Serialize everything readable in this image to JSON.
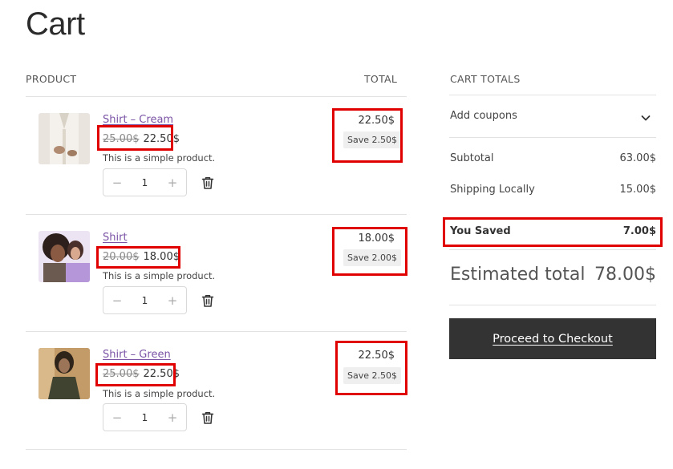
{
  "page": {
    "title": "Cart"
  },
  "table": {
    "col_product": "PRODUCT",
    "col_total": "TOTAL"
  },
  "items": [
    {
      "name": "Shirt – Cream",
      "regular_price": "25.00$",
      "sale_price": "22.50$",
      "description": "This is a simple product.",
      "quantity": "1",
      "line_total": "22.50$",
      "save_label": "Save 2.50$",
      "thumb_palette": [
        "#e9e4de",
        "#cfc7bb",
        "#8c7b6a"
      ]
    },
    {
      "name": "Shirt",
      "regular_price": "20.00$",
      "sale_price": "18.00$",
      "description": "This is a simple product.",
      "quantity": "1",
      "line_total": "18.00$",
      "save_label": "Save 2.00$",
      "thumb_palette": [
        "#d9c9e6",
        "#b79ad6",
        "#3b2a2a"
      ]
    },
    {
      "name": "Shirt – Green",
      "regular_price": "25.00$",
      "sale_price": "22.50$",
      "description": "This is a simple product.",
      "quantity": "1",
      "line_total": "22.50$",
      "save_label": "Save 2.50$",
      "thumb_palette": [
        "#c7a06e",
        "#4a4a35",
        "#2a2418"
      ]
    }
  ],
  "stepper": {
    "minus": "−",
    "plus": "+"
  },
  "totals": {
    "heading": "CART TOTALS",
    "coupons_label": "Add coupons",
    "subtotal_label": "Subtotal",
    "subtotal_value": "63.00$",
    "shipping_label": "Shipping Locally",
    "shipping_value": "15.00$",
    "saved_label": "You Saved",
    "saved_value": "7.00$",
    "estimated_label": "Estimated total",
    "estimated_value": "78.00$",
    "checkout_label": "Proceed to Checkout"
  },
  "colors": {
    "link": "#7b54a6",
    "highlight": "#e00000",
    "button": "#333333"
  }
}
